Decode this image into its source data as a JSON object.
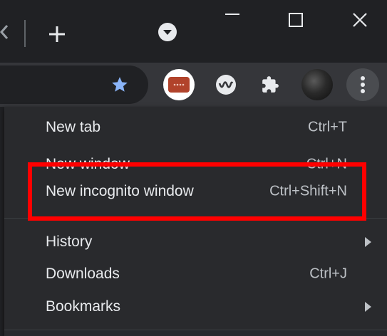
{
  "titlebar": {
    "icons": {
      "new_tab": "plus-icon",
      "tab_search": "chevron-down-circle-icon",
      "minimize": "minimize-icon",
      "maximize": "maximize-icon",
      "close": "close-icon"
    }
  },
  "toolbar": {
    "icons": {
      "bookmark": "star-icon",
      "extension_1": "extension-app-icon",
      "extension_2": "wave-icon",
      "extensions": "puzzle-icon",
      "profile": "profile-avatar",
      "menu": "more-vertical-icon"
    }
  },
  "menu": {
    "items": [
      {
        "label": "New tab",
        "shortcut": "Ctrl+T",
        "submenu": false
      },
      {
        "label": "New window",
        "shortcut": "Ctrl+N",
        "submenu": false
      },
      {
        "label": "New incognito window",
        "shortcut": "Ctrl+Shift+N",
        "submenu": false,
        "highlighted": true
      },
      {
        "label": "History",
        "shortcut": "",
        "submenu": true
      },
      {
        "label": "Downloads",
        "shortcut": "Ctrl+J",
        "submenu": false
      },
      {
        "label": "Bookmarks",
        "shortcut": "",
        "submenu": true
      }
    ]
  },
  "colors": {
    "titlebar_bg": "#202124",
    "toolbar_bg": "#35363a",
    "menu_bg": "#292a2d",
    "menu_text": "#e8eaed",
    "shortcut_text": "#bdc1c6",
    "star_accent": "#8ab4f8",
    "highlight": "#ff0000"
  }
}
